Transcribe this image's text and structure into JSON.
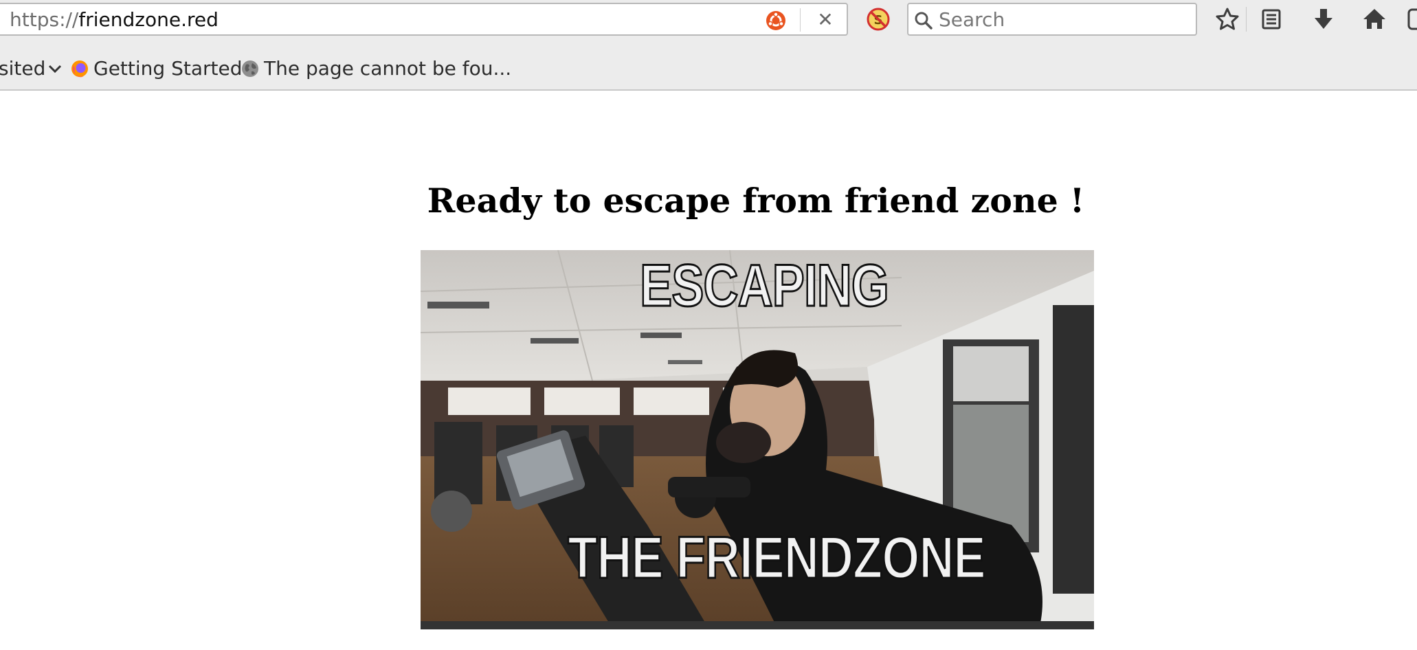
{
  "toolbar": {
    "url_scheme": "https://",
    "url_host": "friendzone.red",
    "search_placeholder": "Search",
    "clear_symbol": "✕",
    "icons": [
      "ubuntu-icon",
      "noscript-icon",
      "search-icon",
      "bookmark-star-icon",
      "reading-list-icon",
      "download-icon",
      "home-icon"
    ]
  },
  "bookmarks": {
    "most_visited": "sited",
    "getting_started": "Getting Started",
    "page_not_found": "The page cannot be fou..."
  },
  "page": {
    "heading": "Ready to escape from friend zone !",
    "meme_top": "ESCAPING",
    "meme_bottom": "THE  FRIENDZONE"
  },
  "colors": {
    "chrome_bg": "#ececec",
    "ubuntu_orange": "#e95420",
    "noscript_red": "#d32f2f",
    "meme_caption": "#f2f2f2"
  }
}
